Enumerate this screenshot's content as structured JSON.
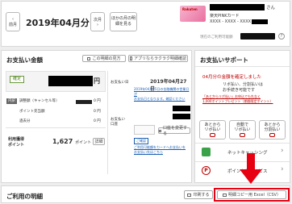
{
  "header": {
    "prev_label": "前月",
    "month_title": "2019年04月分",
    "next_label": "次月",
    "other_months_label": "ほかの月の明細を見る",
    "user_suffix": "さん",
    "card_name": "楽天PINKカード",
    "card_number": "XXXX - XXXX - XXXX -",
    "settlement_label": "現在のご利用可能額",
    "card_brand": "Rakuten"
  },
  "payment": {
    "title": "お支払い金額",
    "view_method_label": "この明細の見方",
    "app_check_label": "アプリならラクラク明細確認",
    "status_badge": "確定",
    "yen": "円",
    "breakdown_badge": "内訳",
    "adjustment_label": "調整額（キャンセル等）",
    "points_label": "ポイント充当額",
    "misc_label": "過去分",
    "zero1": "0 円",
    "zero2": "0 円",
    "zero3": "0 円",
    "usage_points_label1": "利用獲得",
    "usage_points_label2": "ポイント",
    "points_value": "1,627",
    "points_unit": "ポイント",
    "detail_label": "詳細",
    "payday_label": "お支払い日",
    "payday_value": "2019年04月27日",
    "payday_note1": "2019年04月25日の金融機関の営業日が",
    "payday_note2": "お支払日となります。確認ください",
    "account_label1": "お支払い",
    "account_label2": "口座",
    "account_change_label": "口座を変更する",
    "confirm_label": "ご確認",
    "account_note1": "ご利用可能額をカードへお支払いを",
    "account_note2": "お支払い先はこちら"
  },
  "support": {
    "title": "お支払いサポート",
    "notice1": "04月分の金額を確定しました",
    "notice2": "リボ払い、分割払いは",
    "notice3": "お手続き可能です",
    "promo1": "「あとからリボ払い」お申込でもれなく",
    "promo2": "1,000ポイントプレゼント（期間限定ポイント）",
    "svc1_line1": "あとから",
    "svc1_line2": "リボ払い",
    "svc2_line1": "自動で",
    "svc2_line2": "リボ払い",
    "svc3_line1": "あとから",
    "svc3_line2": "分割払い",
    "netbank_label": "ネットキャッシング",
    "points_service_label": "ポイントでサービス",
    "netbank_icon_text": "キャッシング",
    "points_icon_text": "P",
    "chevron": "›"
  },
  "usage": {
    "title": "ご利用の明細",
    "print_label": "印刷する",
    "csv_label": "明細コピー用 Excel（CSV）"
  }
}
